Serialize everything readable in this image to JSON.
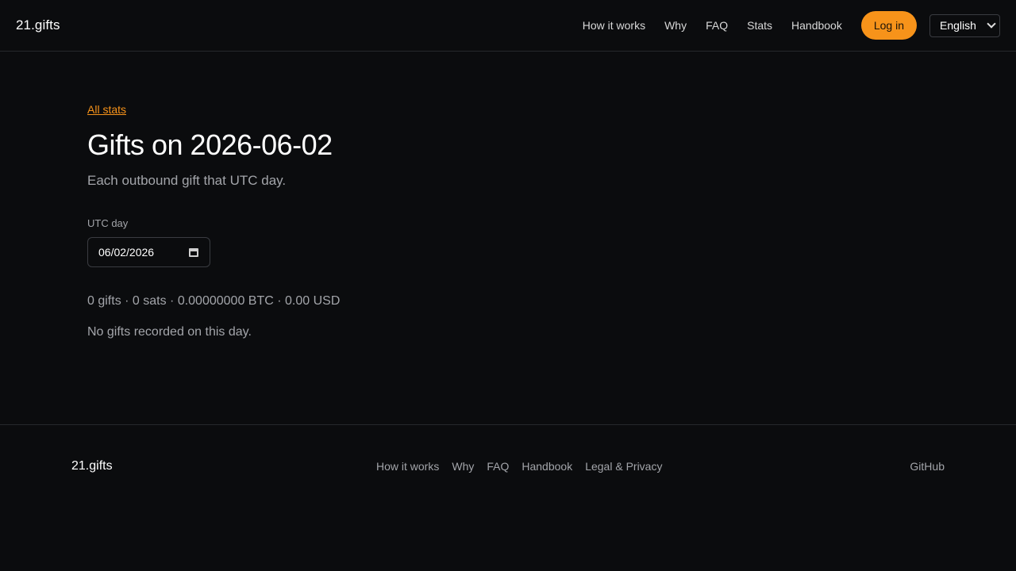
{
  "header": {
    "brand": "21.gifts",
    "nav": [
      {
        "label": "How it works"
      },
      {
        "label": "Why"
      },
      {
        "label": "FAQ"
      },
      {
        "label": "Stats"
      },
      {
        "label": "Handbook"
      }
    ],
    "login_label": "Log in",
    "language": "English"
  },
  "main": {
    "back_link": "All stats",
    "title": "Gifts on 2026-06-02",
    "subtitle": "Each outbound gift that UTC day.",
    "day_label": "UTC day",
    "day_value": "06/02/2026",
    "summary": "0 gifts · 0 sats · 0.00000000 BTC · 0.00 USD",
    "empty_note": "No gifts recorded on this day."
  },
  "footer": {
    "brand": "21.gifts",
    "nav": [
      {
        "label": "How it works"
      },
      {
        "label": "Why"
      },
      {
        "label": "FAQ"
      },
      {
        "label": "Handbook"
      },
      {
        "label": "Legal & Privacy"
      }
    ],
    "github": "GitHub"
  },
  "colors": {
    "background": "#0b0c0e",
    "accent": "#f7931a",
    "muted_text": "#a3a5aa",
    "border": "#26282c"
  }
}
